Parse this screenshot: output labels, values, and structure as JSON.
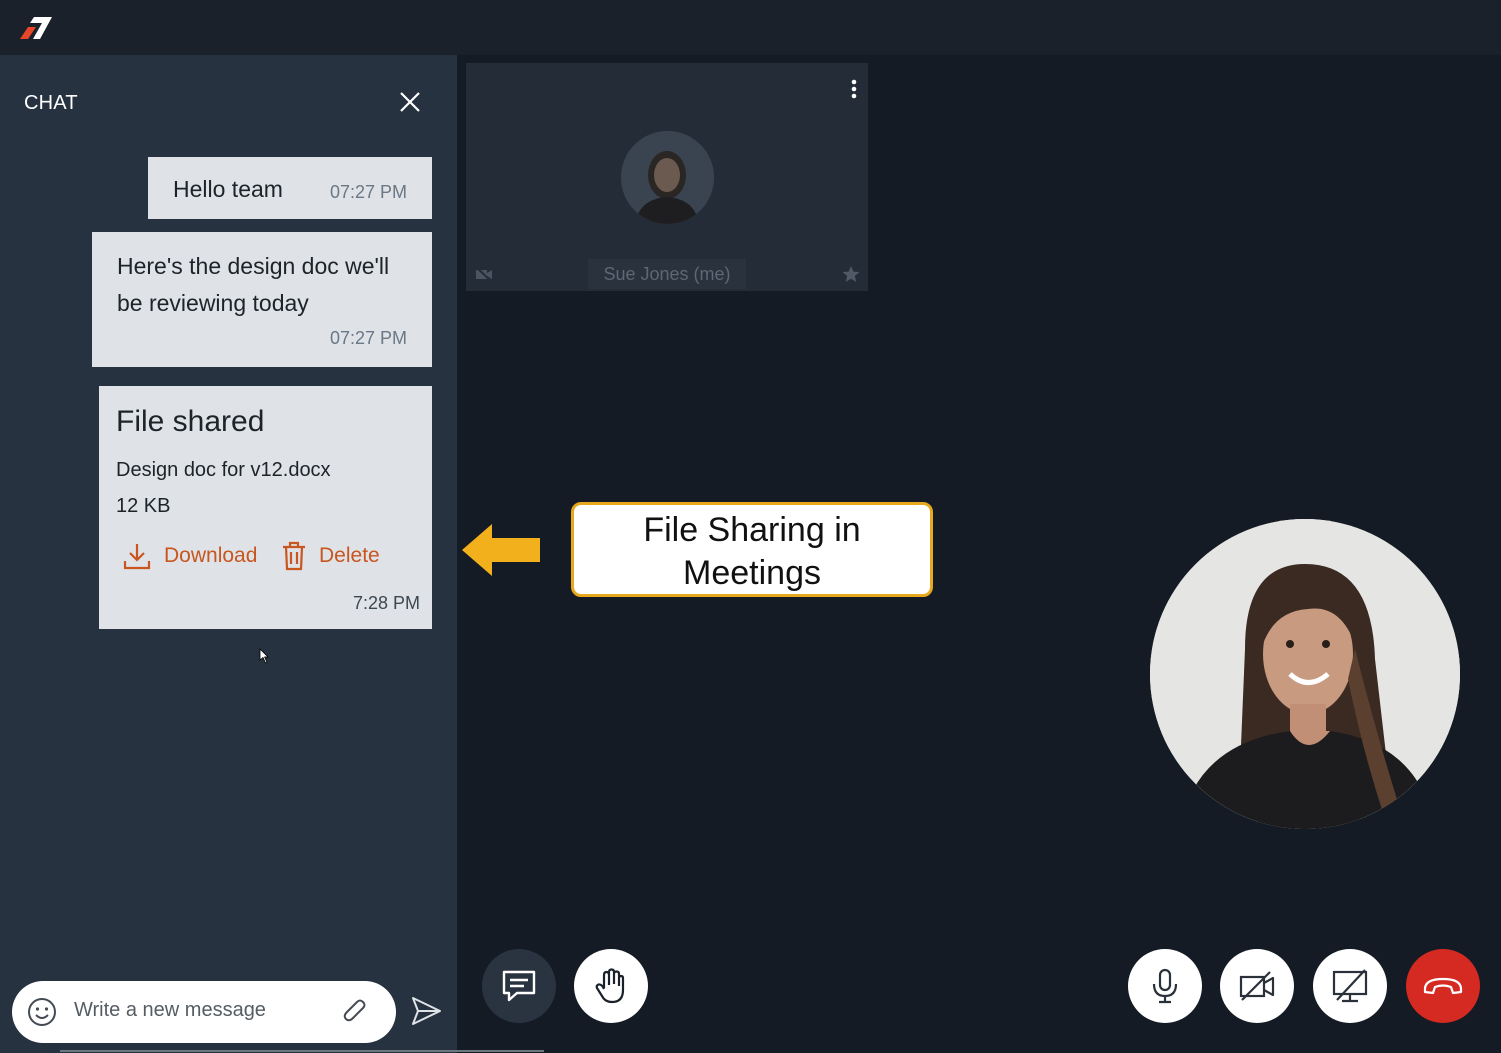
{
  "chat": {
    "title": "CHAT",
    "messages": [
      {
        "text": "Hello team",
        "time": "07:27 PM"
      },
      {
        "text": "Here's the design doc we'll be reviewing today",
        "time": "07:27 PM"
      }
    ],
    "file": {
      "heading": "File shared",
      "name": "Design doc for v12.docx",
      "size": "12 KB",
      "download_label": "Download",
      "delete_label": "Delete",
      "time": "7:28 PM"
    },
    "composer": {
      "placeholder": "Write a new message"
    }
  },
  "participant": {
    "name": "Sue Jones (me)"
  },
  "callout": {
    "text": "File Sharing in Meetings"
  },
  "colors": {
    "accent": "#c8561e",
    "end_call": "#d42a22",
    "callout_border": "#e8a81c",
    "arrow": "#f2b01d"
  },
  "icons": [
    "logo",
    "close-icon",
    "download-icon",
    "trash-icon",
    "emoji-icon",
    "paperclip-icon",
    "send-icon",
    "more-vertical-icon",
    "camera-off-icon",
    "star-icon",
    "chat-icon",
    "raise-hand-icon",
    "microphone-icon",
    "video-off-icon",
    "screen-share-off-icon",
    "end-call-icon"
  ]
}
